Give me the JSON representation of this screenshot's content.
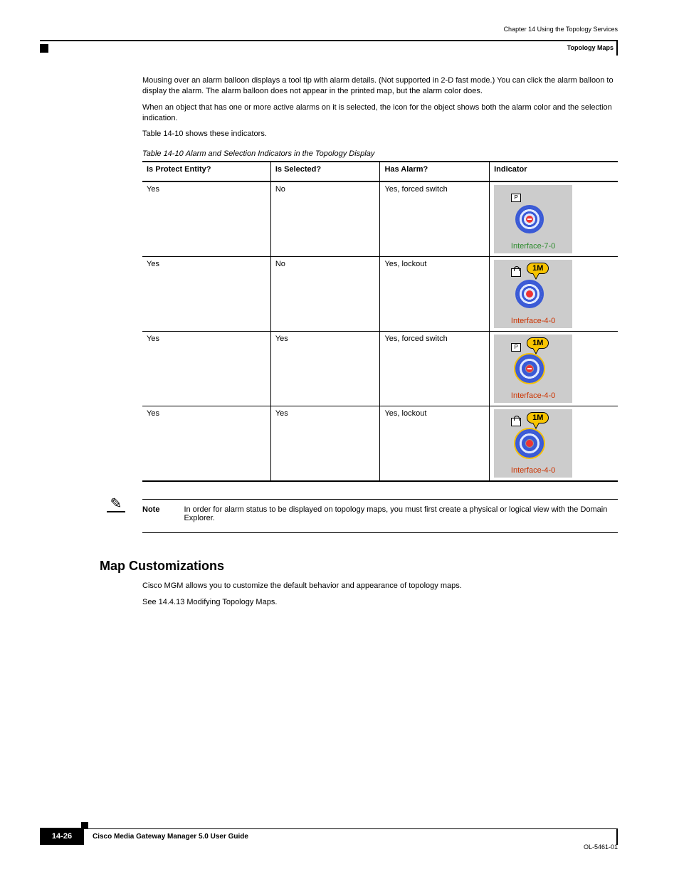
{
  "running_head": {
    "chapter": "Chapter 14      Using the Topology Services",
    "section": "Topology Maps"
  },
  "intro": {
    "p1": "Mousing over an alarm balloon displays a tool tip with alarm details. (Not supported in 2-D fast mode.) You can click the alarm balloon to display the alarm. The alarm balloon does not appear in the printed map, but the alarm color does.",
    "p2": "When an object that has one or more active alarms on it is selected, the icon for the object shows both the alarm color and the selection indication.",
    "p3_a": "Table 14-10",
    "p3_b": " shows these indicators."
  },
  "table": {
    "caption_em": "Table 14-10",
    "caption_rest": "Alarm and Selection Indicators in the Topology Display",
    "headers": [
      "Is Protect Entity?",
      "Is Selected?",
      "Has Alarm?",
      "Indicator"
    ],
    "rows": [
      {
        "c0": "Yes",
        "c1": "No",
        "c2": "Yes, forced switch",
        "icon": {
          "variant": "green",
          "minus": true,
          "badge_p": true,
          "lock": false,
          "bubble": "",
          "label": "Interface-7-0",
          "label_class": "green",
          "selected": false
        }
      },
      {
        "c0": "Yes",
        "c1": "No",
        "c2": "Yes, lockout",
        "icon": {
          "variant": "red",
          "minus": false,
          "badge_p": false,
          "lock": true,
          "bubble": "1M",
          "label": "Interface-4-0",
          "label_class": "red",
          "selected": false
        }
      },
      {
        "c0": "Yes",
        "c1": "Yes",
        "c2": "Yes, forced switch",
        "icon": {
          "variant": "red",
          "minus": true,
          "badge_p": true,
          "lock": false,
          "bubble": "1M",
          "label": "Interface-4-0",
          "label_class": "red",
          "selected": true
        }
      },
      {
        "c0": "Yes",
        "c1": "Yes",
        "c2": "Yes, lockout",
        "icon": {
          "variant": "red",
          "minus": false,
          "badge_p": false,
          "lock": true,
          "bubble": "1M",
          "label": "Interface-4-0",
          "label_class": "red",
          "selected": true
        }
      }
    ]
  },
  "note": {
    "label": "Note",
    "text": "In order for alarm status to be displayed on topology maps, you must first create a physical or logical view with the Domain Explorer."
  },
  "section_after": {
    "heading": "Map Customizations",
    "p1": "Cisco MGM allows you to customize the default behavior and appearance of topology maps.",
    "p2_a": "See ",
    "p2_link": "14.4.13  Modifying Topology Maps",
    "p2_b": "."
  },
  "footer": {
    "book": "Cisco Media Gateway Manager 5.0 User Guide",
    "ol": "OL-5461-01",
    "page": "14-26"
  }
}
